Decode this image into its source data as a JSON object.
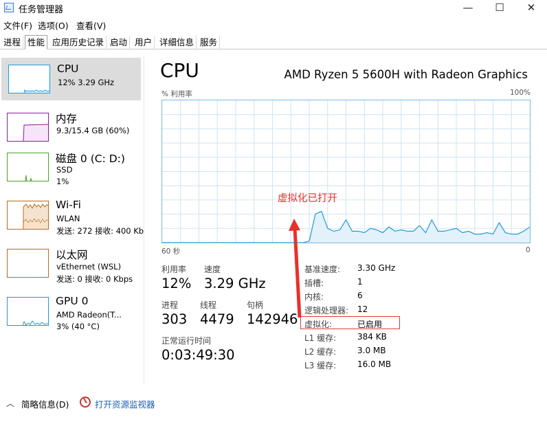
{
  "window": {
    "title": "任务管理器",
    "controls": {
      "minimize": "—",
      "maximize": "☐",
      "close": "✕"
    }
  },
  "menu": [
    "文件(F)",
    "选项(O)",
    "查看(V)"
  ],
  "tabs": [
    {
      "label": "进程",
      "active": false
    },
    {
      "label": "性能",
      "active": true
    },
    {
      "label": "应用历史记录",
      "active": false
    },
    {
      "label": "启动",
      "active": false
    },
    {
      "label": "用户",
      "active": false
    },
    {
      "label": "详细信息",
      "active": false
    },
    {
      "label": "服务",
      "active": false
    }
  ],
  "sidebar": [
    {
      "title": "CPU",
      "line1": "12% 3.29 GHz",
      "line2": "",
      "color": "#1f9bd6",
      "selected": true
    },
    {
      "title": "内存",
      "line1": "9.3/15.4 GB (60%)",
      "line2": "",
      "color": "#8b1a9b",
      "selected": false
    },
    {
      "title": "磁盘 0 (C: D:)",
      "line1": "SSD",
      "line2": "1%",
      "color": "#4aa12a",
      "selected": false
    },
    {
      "title": "Wi-Fi",
      "line1": "WLAN",
      "line2": "发送: 272  接收: 400 Kb",
      "color": "#b86a1a",
      "selected": false
    },
    {
      "title": "以太网",
      "line1": "vEthernet (WSL)",
      "line2": "发送: 0  接收: 0 Kbps",
      "color": "#b86a1a",
      "selected": false
    },
    {
      "title": "GPU 0",
      "line1": "AMD Radeon(T...",
      "line2": "3% (40 °C)",
      "color": "#1f9bd6",
      "selected": false
    }
  ],
  "main": {
    "title": "CPU",
    "model": "AMD Ryzen 5 5600H with Radeon Graphics",
    "graph_label_left": "% 利用率",
    "graph_label_right": "100%",
    "time_left": "60 秒",
    "time_right": "0",
    "annotation": "虚拟化已打开"
  },
  "chart_data": {
    "type": "area",
    "title": "",
    "x": [
      60,
      59,
      58,
      57,
      56,
      55,
      54,
      53,
      52,
      51,
      50,
      49,
      48,
      47,
      46,
      45,
      44,
      43,
      42,
      41,
      40,
      39,
      38,
      37,
      36,
      35,
      34,
      33,
      32,
      31,
      30,
      29,
      28,
      27,
      26,
      25,
      24,
      23,
      22,
      21,
      20,
      19,
      18,
      17,
      16,
      15,
      14,
      13,
      12,
      11,
      10,
      9,
      8,
      7,
      6,
      5,
      4,
      3,
      2,
      1,
      0
    ],
    "values": [
      0,
      0,
      0,
      0,
      0,
      0,
      0,
      0,
      0,
      0,
      0,
      0,
      0,
      0,
      0,
      0,
      0,
      0,
      0,
      0,
      0,
      0,
      0,
      0,
      1,
      20,
      22,
      10,
      8,
      9,
      16,
      8,
      8,
      7,
      10,
      9,
      7,
      11,
      8,
      9,
      8,
      8,
      12,
      7,
      16,
      8,
      8,
      9,
      10,
      7,
      8,
      6,
      6,
      7,
      6,
      14,
      7,
      6,
      6,
      8,
      11
    ],
    "ylim": [
      0,
      100
    ],
    "grid": true
  },
  "stats": {
    "utilization": {
      "label": "利用率",
      "value": "12%"
    },
    "speed": {
      "label": "速度",
      "value": "3.29 GHz"
    },
    "processes": {
      "label": "进程",
      "value": "303"
    },
    "threads": {
      "label": "线程",
      "value": "4479"
    },
    "handles": {
      "label": "句柄",
      "value": "142946"
    },
    "uptime": {
      "label": "正常运行时间",
      "value": "0:03:49:30"
    }
  },
  "details": [
    {
      "label": "基准速度:",
      "value": "3.30 GHz"
    },
    {
      "label": "插槽:",
      "value": "1"
    },
    {
      "label": "内核:",
      "value": "6"
    },
    {
      "label": "逻辑处理器:",
      "value": "12"
    },
    {
      "label": "虚拟化:",
      "value": "已启用"
    },
    {
      "label": "L1 缓存:",
      "value": "384 KB"
    },
    {
      "label": "L2 缓存:",
      "value": "3.0 MB"
    },
    {
      "label": "L3 缓存:",
      "value": "16.0 MB"
    }
  ],
  "bottom": {
    "brief": "简略信息(D)",
    "resmon": "打开资源监视器"
  },
  "colors": {
    "graph_line": "#1f9bd6",
    "graph_fill": "#e3f1fb",
    "grid": "#cfe4f3",
    "annotation": "#e8302c"
  }
}
